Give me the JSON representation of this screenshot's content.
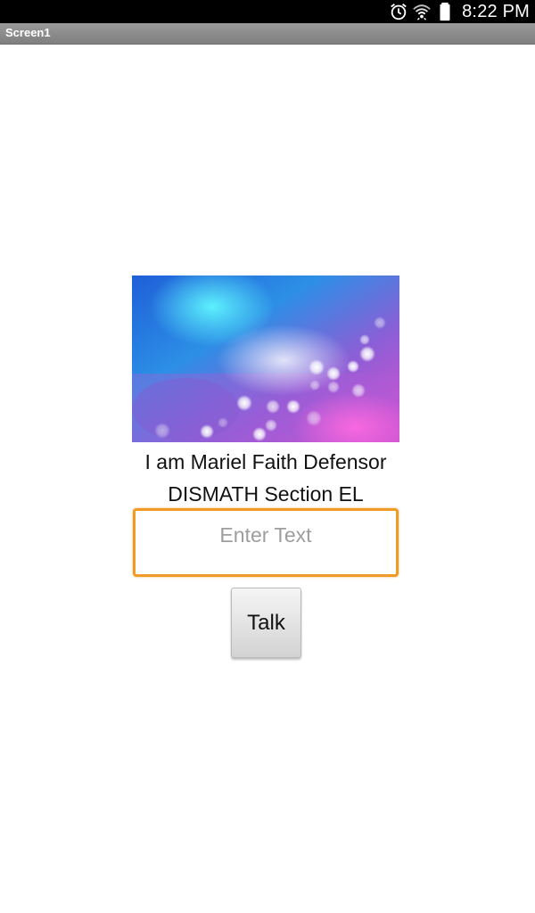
{
  "status_bar": {
    "time": "8:22 PM",
    "icons": [
      "alarm-icon",
      "wifi-icon",
      "battery-icon"
    ]
  },
  "screen": {
    "title": "Screen1"
  },
  "main": {
    "image": "blue-purple-bokeh-background",
    "label_line1": "I am Mariel Faith Defensor",
    "label_line2": "DISMATH Section EL",
    "input_placeholder": "Enter Text",
    "input_value": "",
    "button_label": "Talk"
  },
  "colors": {
    "status_bar": "#000000",
    "title_bar": "#8a8a8a",
    "input_focus_border": "#f09a28",
    "button_face": "#e2e2e2"
  }
}
